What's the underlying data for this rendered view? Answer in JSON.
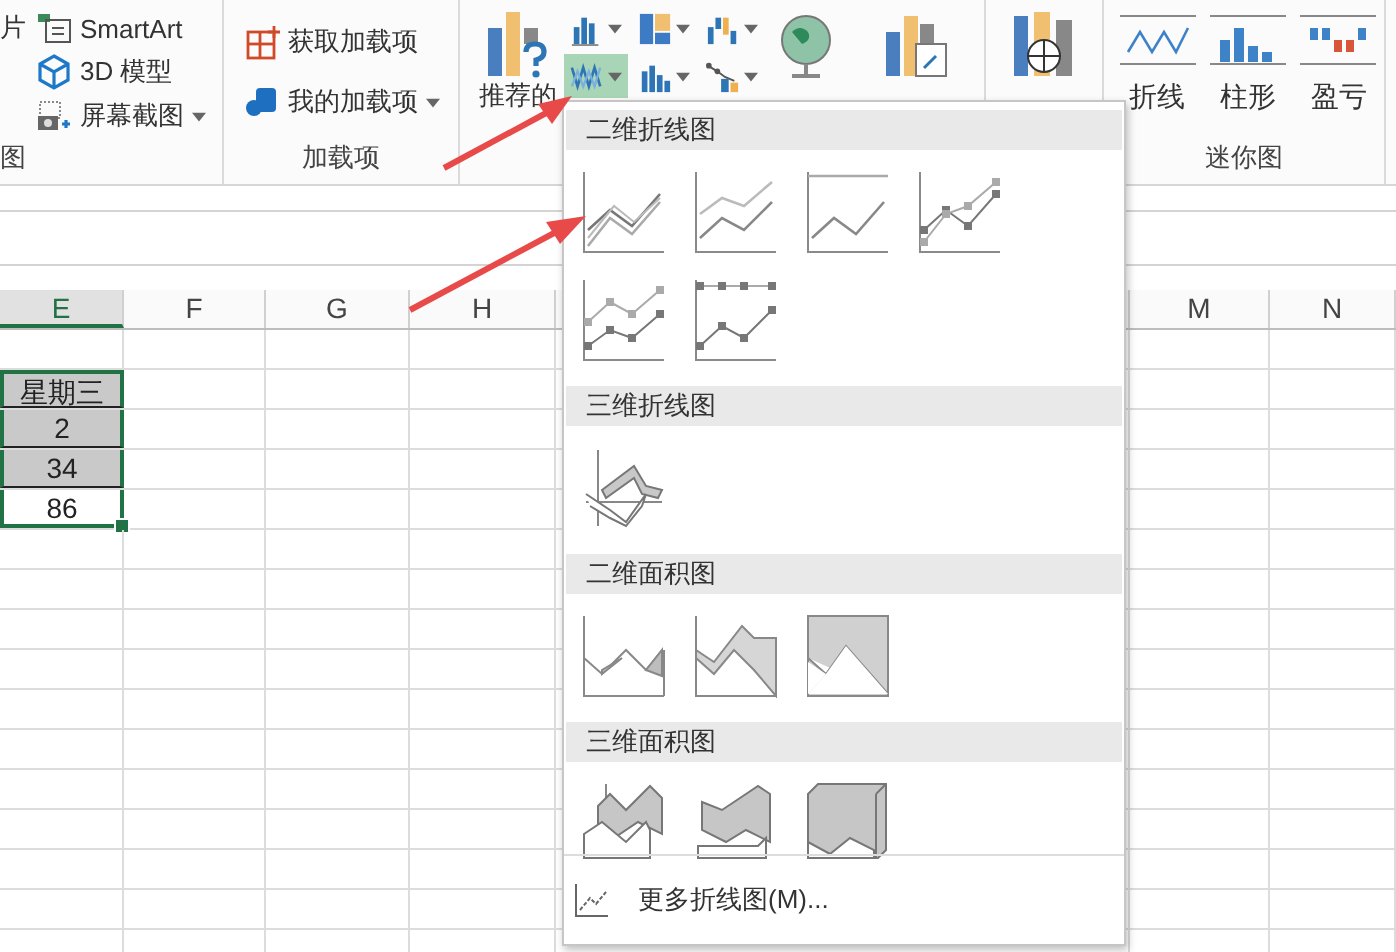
{
  "ribbon": {
    "groups": [
      {
        "kind": "illustrations",
        "label": "图",
        "items": [
          {
            "label": "片",
            "dropdown": false
          },
          {
            "label": "SmartArt",
            "dropdown": false
          },
          {
            "label": "3D 模型",
            "dropdown": false
          },
          {
            "label": "屏幕截图",
            "dropdown": true
          }
        ]
      },
      {
        "kind": "addins",
        "label": "加载项",
        "items": [
          {
            "label": "获取加载项",
            "dropdown": false
          },
          {
            "label": "我的加载项",
            "dropdown": true
          }
        ]
      },
      {
        "kind": "charts",
        "recommended": "推荐的",
        "small": [
          {
            "selected": false
          },
          {
            "selected": false
          },
          {
            "selected": false
          },
          {
            "selected": true
          },
          {
            "selected": false
          },
          {
            "selected": false
          }
        ]
      },
      {
        "kind": "tours"
      },
      {
        "kind": "sparklines",
        "label": "迷你图",
        "items": [
          {
            "label": "折线"
          },
          {
            "label": "柱形"
          },
          {
            "label": "盈亏"
          }
        ]
      }
    ]
  },
  "sheet": {
    "columns": [
      {
        "label": "E",
        "selected": true
      },
      {
        "label": "F",
        "selected": false
      },
      {
        "label": "G",
        "selected": false
      },
      {
        "label": "H",
        "selected": false
      },
      {
        "label": "M",
        "selected": false
      },
      {
        "label": "N",
        "selected": false
      }
    ],
    "cells": [
      {
        "text": "星期三",
        "shaded": true,
        "selected": true
      },
      {
        "text": "2",
        "shaded": true,
        "selected": true
      },
      {
        "text": "34",
        "shaded": true,
        "selected": true
      },
      {
        "text": "86",
        "shaded": false,
        "selected": true
      }
    ]
  },
  "chart_menu": {
    "sections": [
      {
        "title": "二维折线图",
        "items": [
          {
            "kind": "line"
          },
          {
            "kind": "stacked_line"
          },
          {
            "kind": "stacked_line_100"
          },
          {
            "kind": "line_markers"
          },
          {
            "kind": "stacked_line_markers"
          },
          {
            "kind": "stacked_line_100_markers"
          }
        ]
      },
      {
        "title": "三维折线图",
        "items": [
          {
            "kind": "line_3d"
          }
        ]
      },
      {
        "title": "二维面积图",
        "items": [
          {
            "kind": "area"
          },
          {
            "kind": "stacked_area"
          },
          {
            "kind": "area_100"
          }
        ]
      },
      {
        "title": "三维面积图",
        "items": [
          {
            "kind": "area_3d"
          },
          {
            "kind": "stacked_area_3d"
          },
          {
            "kind": "area_100_3d"
          }
        ]
      }
    ],
    "more": "更多折线图(M)..."
  }
}
